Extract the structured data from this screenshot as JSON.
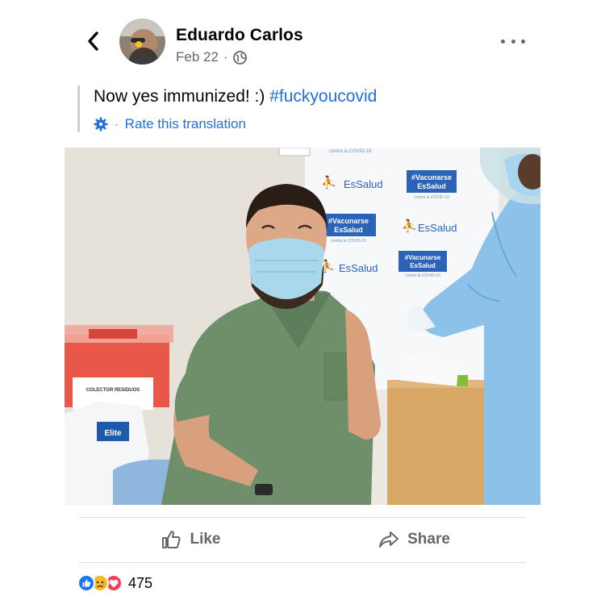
{
  "post": {
    "author_name": "Eduardo Carlos",
    "date": "Feb 22",
    "separator": "·",
    "privacy_icon": "globe-icon",
    "text": "Now yes immunized! :) ",
    "hashtag": "#fuckyoucovid",
    "translation": {
      "icon": "gear-icon",
      "separator": "·",
      "label": "Rate this translation"
    }
  },
  "photo": {
    "banner_brand": "EsSalud",
    "banner_tag_line1": "#Vacunarse",
    "banner_tag_line2": "EsSalud",
    "banner_sub": "contra la COVID-19",
    "banner_top_text": "contra la COVID-19",
    "container_label": "COLECTOR RESIDUOS",
    "bag_label": "Elite"
  },
  "actions": {
    "like_label": "Like",
    "share_label": "Share"
  },
  "reactions": {
    "icons": [
      "like-reaction-icon",
      "sad-reaction-icon",
      "love-reaction-icon"
    ],
    "count": "475"
  },
  "colors": {
    "link_blue": "#216fdb",
    "secondary_text": "#65676b",
    "like_blue": "#1877f2",
    "love_red": "#f33e58",
    "sad_yellow": "#f7b928"
  }
}
